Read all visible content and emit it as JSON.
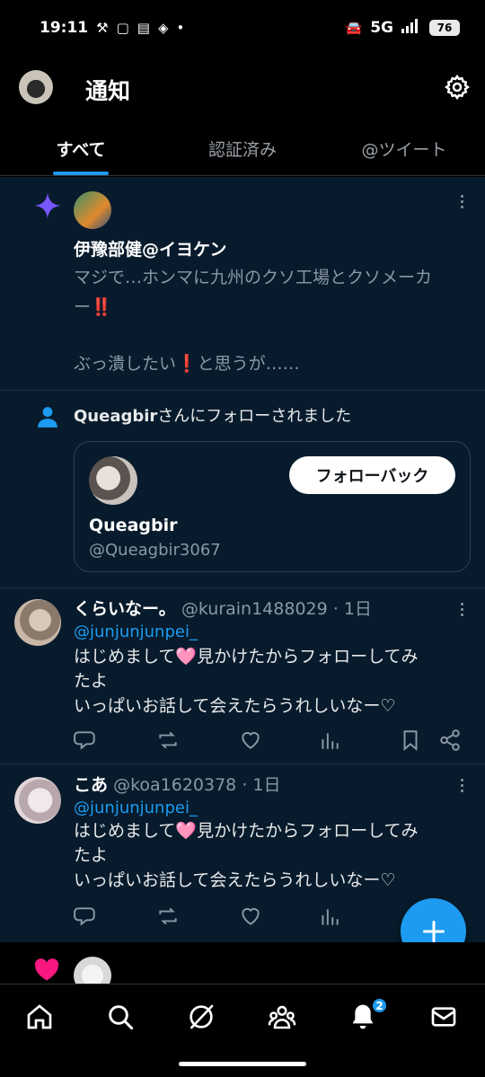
{
  "status_bar": {
    "time": "19:11",
    "network": "5G",
    "battery": "76"
  },
  "header": {
    "title": "通知"
  },
  "tabs": [
    {
      "label": "すべて"
    },
    {
      "label": "認証済み"
    },
    {
      "label": "@ツイート"
    }
  ],
  "notification_1": {
    "user_name": "伊豫部健@イヨケン",
    "text_line1": "マジで…ホンマに九州のクソ工場とクソメーカ",
    "text_line2": "ー‼️",
    "text_line3": "ぶっ潰したい❗と思うが……"
  },
  "follow_notification": {
    "text_name": "Queagbir",
    "text_rest": "さんにフォローされました",
    "card_name": "Queagbir",
    "card_handle": "@Queagbir3067",
    "follow_back_label": "フォローバック"
  },
  "reply_1": {
    "display_name": "くらいなー。",
    "handle": "@kurain1488029",
    "time": "· 1日",
    "mention": "@junjunjunpei_",
    "line1": "はじめまして🩷見かけたからフォローしてみ",
    "line2": "たよ",
    "line3": "いっぱいお話して会えたらうれしいなー♡"
  },
  "reply_2": {
    "display_name": "こあ",
    "handle": "@koa1620378",
    "time": "· 1日",
    "mention": "@junjunjunpei_",
    "line1": "はじめまして🩷見かけたからフォローしてみ",
    "line2": "たよ",
    "line3": "いっぱいお話して会えたらうれしいなー♡"
  },
  "nav": {
    "notifications_badge": "2"
  },
  "colors": {
    "accent": "#1d9bf0",
    "feed_bg": "#071b2c",
    "like": "#f91880",
    "sparkle": "#7856ff"
  }
}
